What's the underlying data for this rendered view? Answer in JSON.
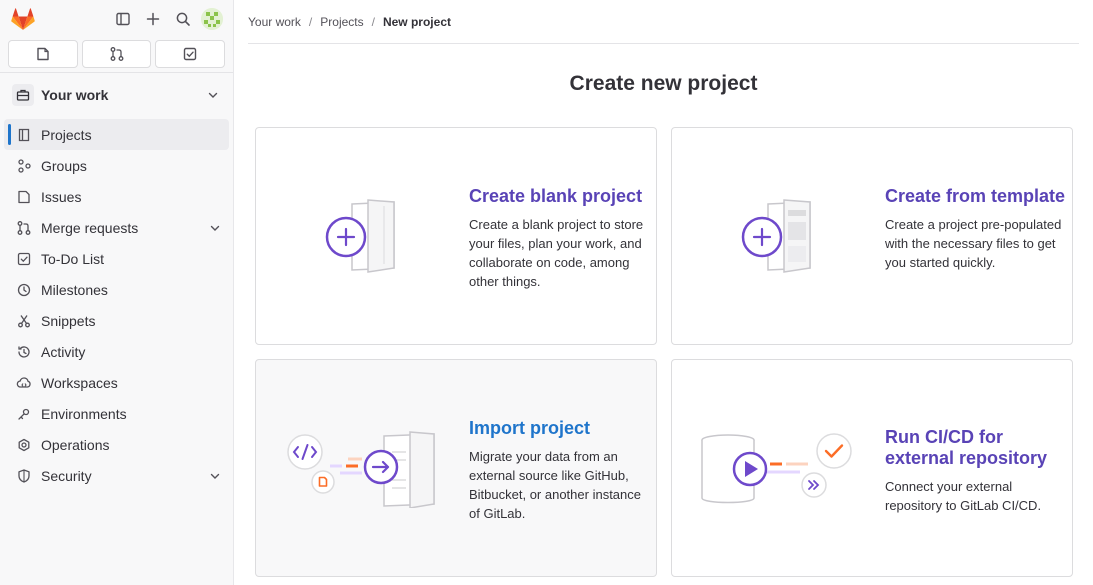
{
  "sidebar": {
    "context_label": "Your work",
    "items": [
      {
        "label": "Projects",
        "icon": "project-icon"
      },
      {
        "label": "Groups",
        "icon": "group-icon"
      },
      {
        "label": "Issues",
        "icon": "issues-icon"
      },
      {
        "label": "Merge requests",
        "icon": "merge-request-icon"
      },
      {
        "label": "To-Do List",
        "icon": "todo-icon"
      },
      {
        "label": "Milestones",
        "icon": "milestone-icon"
      },
      {
        "label": "Snippets",
        "icon": "snippet-icon"
      },
      {
        "label": "Activity",
        "icon": "history-icon"
      },
      {
        "label": "Workspaces",
        "icon": "workspace-icon"
      },
      {
        "label": "Environments",
        "icon": "environment-icon"
      },
      {
        "label": "Operations",
        "icon": "operations-icon"
      },
      {
        "label": "Security",
        "icon": "shield-icon"
      }
    ]
  },
  "breadcrumb": {
    "items": [
      "Your work",
      "Projects"
    ],
    "current": "New project"
  },
  "page": {
    "title": "Create new project"
  },
  "cards": [
    {
      "title": "Create blank project",
      "description": "Create a blank project to store your files, plan your work, and collaborate on code, among other things."
    },
    {
      "title": "Create from template",
      "description": "Create a project pre-populated with the necessary files to get you started quickly."
    },
    {
      "title": "Import project",
      "description": "Migrate your data from an external source like GitHub, Bitbucket, or another instance of GitLab."
    },
    {
      "title": "Run CI/CD for external repository",
      "description": "Connect your external repository to GitLab CI/CD."
    }
  ],
  "colors": {
    "accent_purple": "#5943b6",
    "accent_blue": "#1f75cb",
    "gitlab_orange": "#e24329"
  }
}
